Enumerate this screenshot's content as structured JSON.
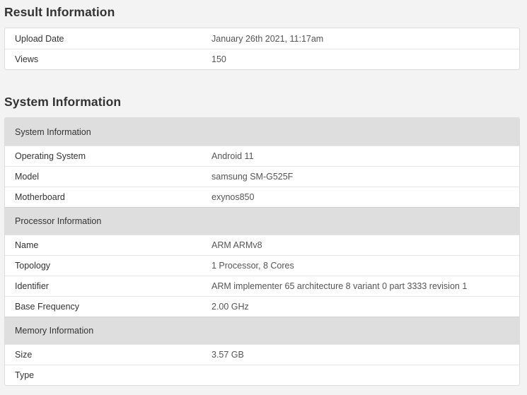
{
  "result": {
    "title": "Result Information",
    "rows": [
      {
        "label": "Upload Date",
        "value": "January 26th 2021, 11:17am"
      },
      {
        "label": "Views",
        "value": "150"
      }
    ]
  },
  "system": {
    "title": "System Information",
    "groups": [
      {
        "header": "System Information",
        "rows": [
          {
            "label": "Operating System",
            "value": "Android 11"
          },
          {
            "label": "Model",
            "value": "samsung SM-G525F"
          },
          {
            "label": "Motherboard",
            "value": "exynos850"
          }
        ]
      },
      {
        "header": "Processor Information",
        "rows": [
          {
            "label": "Name",
            "value": "ARM ARMv8"
          },
          {
            "label": "Topology",
            "value": "1 Processor, 8 Cores"
          },
          {
            "label": "Identifier",
            "value": "ARM implementer 65 architecture 8 variant 0 part 3333 revision 1"
          },
          {
            "label": "Base Frequency",
            "value": "2.00 GHz"
          }
        ]
      },
      {
        "header": "Memory Information",
        "rows": [
          {
            "label": "Size",
            "value": "3.57 GB"
          },
          {
            "label": "Type",
            "value": ""
          }
        ]
      }
    ]
  }
}
